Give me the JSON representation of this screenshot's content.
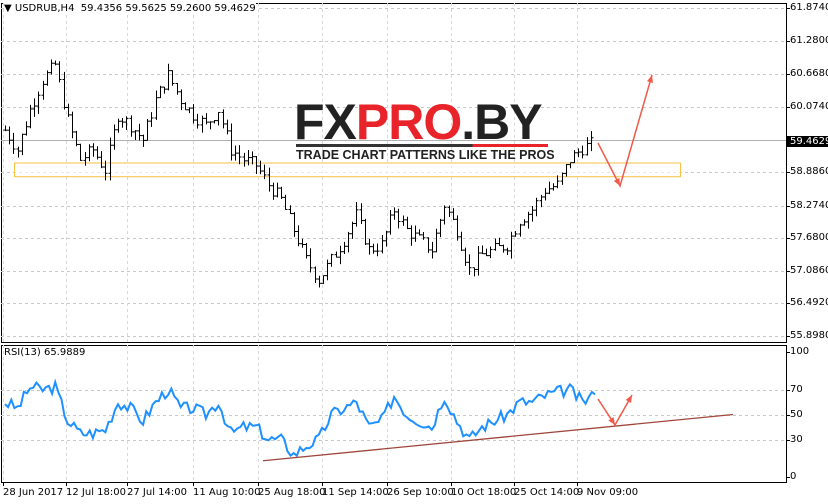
{
  "header": {
    "symbol": "USDRUB,H4",
    "ohlc": "59.4356 59.5625 59.2600 59.4629"
  },
  "rsi_panel": {
    "title": "RSI(13) 65.9889"
  },
  "price_axis": {
    "ticks": [
      "61.8740",
      "61.2800",
      "60.6680",
      "60.0740",
      "58.8860",
      "58.2740",
      "57.6800",
      "57.0860",
      "56.4920",
      "55.8980"
    ],
    "current_price": "59.4629"
  },
  "rsi_axis": {
    "ticks": [
      "100",
      "70",
      "50",
      "30",
      "0"
    ]
  },
  "time_axis": {
    "ticks": [
      "28 Jun 2017",
      "12 Jul 18:00",
      "27 Jul 14:00",
      "11 Aug 10:00",
      "25 Aug 18:00",
      "11 Sep 14:00",
      "26 Sep 10:00",
      "10 Oct 18:00",
      "25 Oct 14:00",
      "9 Nov 09:00"
    ]
  },
  "watermark": {
    "brand_dark1": "FX",
    "brand_red": "PRO",
    "brand_dark2": ".BY",
    "tagline": "TRADE CHART PATTERNS LIKE THE PROS"
  },
  "colors": {
    "rsi_line": "#1e90ff",
    "arrow": "#f05a4a",
    "trendline": "#a0463c",
    "support_zone": "#f5c242"
  },
  "chart_data": {
    "type": "line",
    "price_range": [
      55.898,
      61.874
    ],
    "rsi_range": [
      0,
      100
    ],
    "closes": [
      59.65,
      59.29,
      60.02,
      60.56,
      60.84,
      59.83,
      59.11,
      59.29,
      58.92,
      59.93,
      59.74,
      59.47,
      60.2,
      60.65,
      60.2,
      59.93,
      59.74,
      60.02,
      59.29,
      59.11,
      59.01,
      58.65,
      58.38,
      57.83,
      57.28,
      56.92,
      57.28,
      57.65,
      58.1,
      57.47,
      57.56,
      58.2,
      57.83,
      57.65,
      57.47,
      58.29,
      57.83,
      57.1,
      57.38,
      57.47,
      57.56,
      58.01,
      58.2,
      58.56,
      58.65,
      59.11,
      59.32,
      59.43
    ],
    "rsi": [
      60,
      55,
      72,
      70,
      72,
      45,
      35,
      35,
      38,
      60,
      55,
      45,
      60,
      70,
      55,
      55,
      50,
      60,
      35,
      40,
      40,
      30,
      30,
      18,
      25,
      30,
      50,
      55,
      60,
      40,
      45,
      65,
      50,
      45,
      40,
      65,
      45,
      30,
      40,
      45,
      50,
      60,
      60,
      65,
      68,
      70,
      60,
      66
    ],
    "support_zone": [
      58.8,
      59.05
    ],
    "rsi_trendline": [
      13,
      50
    ]
  }
}
